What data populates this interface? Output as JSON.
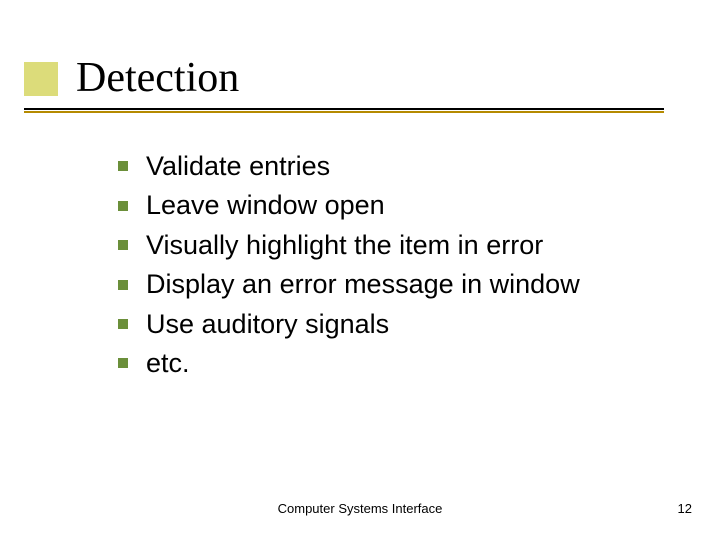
{
  "title": "Detection",
  "bullets": [
    "Validate entries",
    "Leave window open",
    "Visually highlight the item in error",
    "Display an error message in window",
    "Use auditory signals",
    "etc."
  ],
  "footer": {
    "center": "Computer Systems Interface",
    "page_number": "12"
  }
}
